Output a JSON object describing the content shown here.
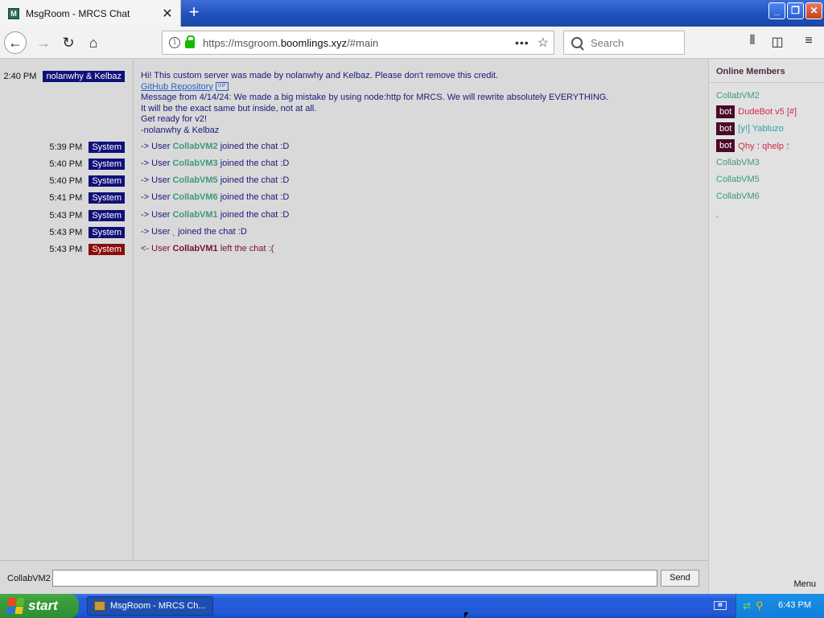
{
  "browser": {
    "tab_title": "MsgRoom - MRCS Chat",
    "tab_close": "✕",
    "new_tab": "+",
    "url_prefix": "https://msgroom.",
    "url_domain": "boomlings.xyz",
    "url_suffix": "/#main",
    "search_placeholder": "Search"
  },
  "chat": {
    "intro": {
      "time": "2:40 PM",
      "author": "nolanwhy & Kelbaz",
      "line1": "Hi! This custom server was made by nolanwhy and Kelbaz. Please don't remove this credit.",
      "link": "GitHub Repository",
      "gif_label": "GIF",
      "line2": "Message from 4/14/24: We made a big mistake by using node:http for MRCS. We will rewrite absolutely EVERYTHING.",
      "line3": "It will be the exact same but inside, not at all.",
      "line4": "Get ready for v2!",
      "line5": "-nolanwhy & Kelbaz"
    },
    "system_messages": [
      {
        "time": "5:39 PM",
        "tag": "System",
        "prefix": "-> User ",
        "user": "CollabVM2",
        "suffix": " joined the chat :D"
      },
      {
        "time": "5:40 PM",
        "tag": "System",
        "prefix": "-> User ",
        "user": "CollabVM3",
        "suffix": " joined the chat :D"
      },
      {
        "time": "5:40 PM",
        "tag": "System",
        "prefix": "-> User ",
        "user": "CollabVM5",
        "suffix": " joined the chat :D"
      },
      {
        "time": "5:41 PM",
        "tag": "System",
        "prefix": "-> User ",
        "user": "CollabVM6",
        "suffix": " joined the chat :D"
      },
      {
        "time": "5:43 PM",
        "tag": "System",
        "prefix": "-> User ",
        "user": "CollabVM1",
        "suffix": " joined the chat :D"
      },
      {
        "time": "5:43 PM",
        "tag": "System",
        "prefix": "-> User ",
        "user": "˛",
        "suffix": " joined the chat :D"
      },
      {
        "time": "5:43 PM",
        "tag": "System",
        "prefix": "<- User ",
        "user": "CollabVM1",
        "suffix": " left the chat :("
      }
    ],
    "input_nick": "CollabVM2",
    "input_value": "",
    "send_label": "Send"
  },
  "members": {
    "title": "Online Members",
    "list": [
      {
        "bot": "",
        "name": "CollabVM2"
      },
      {
        "bot": "bot",
        "name": "DudeBot v5 [#]"
      },
      {
        "bot": "bot",
        "name": "[y!] Yabluzo"
      },
      {
        "bot": "bot",
        "name": "Qhy ؛ qhelp ؛"
      },
      {
        "bot": "",
        "name": "CollabVM3"
      },
      {
        "bot": "",
        "name": "CollabVM5"
      },
      {
        "bot": "",
        "name": "CollabVM6"
      },
      {
        "bot": "",
        "name": "˛"
      }
    ],
    "menu_label": "Menu"
  },
  "taskbar": {
    "start_label": "start",
    "task_title": "MsgRoom - MRCS Ch...",
    "clock": "6:43 PM"
  },
  "icons": {
    "back": "back-arrow-icon",
    "forward": "forward-arrow-icon",
    "reload": "reload-icon",
    "home": "home-icon",
    "library": "library-icon",
    "sidebar": "sidebar-icon",
    "menu": "hamburger-menu-icon"
  },
  "colors": {
    "tag_blue": "#10107a",
    "tag_red": "#8a0d0d",
    "username_green": "#3d9a7a",
    "bot_badge": "#4a0a2a",
    "titlebar_blue": "#245edb"
  }
}
